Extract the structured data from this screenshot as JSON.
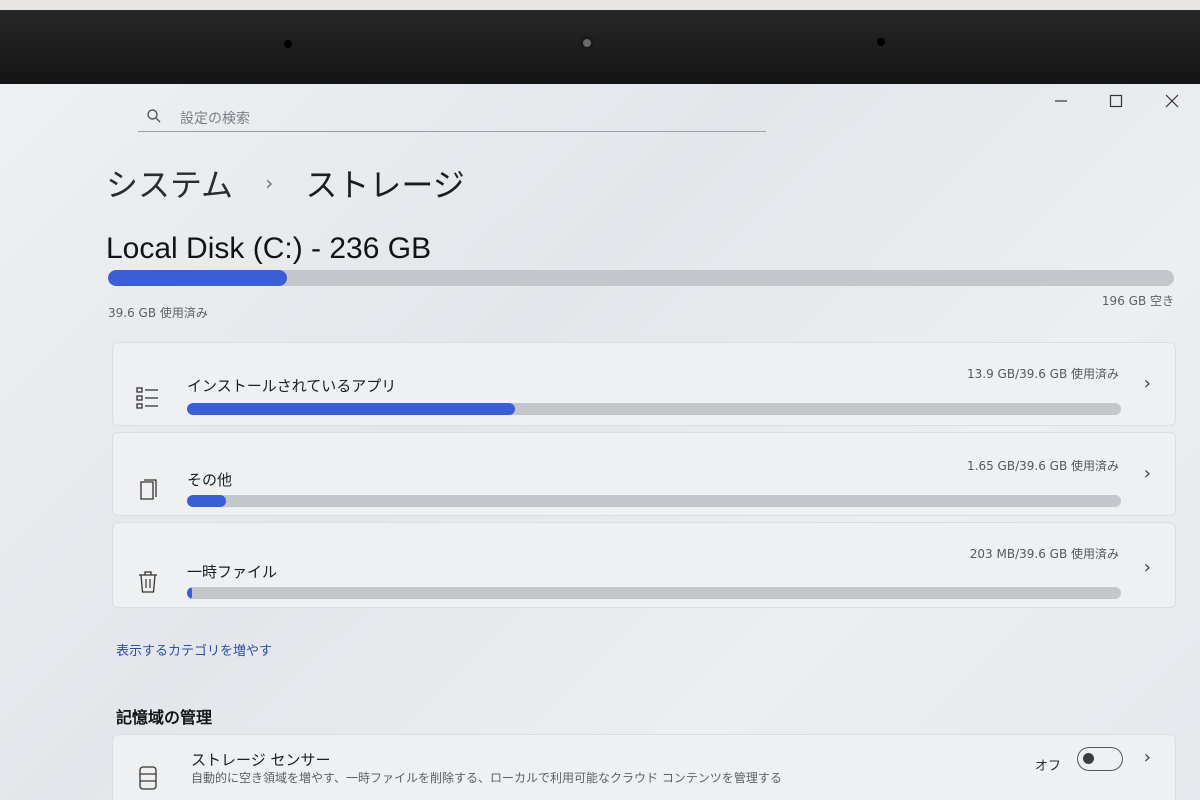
{
  "search": {
    "placeholder": "設定の検索"
  },
  "breadcrumb": {
    "parent": "システム",
    "separator": "›",
    "current": "ストレージ"
  },
  "disk": {
    "title": "Local Disk (C:) - 236 GB",
    "used_label": "39.6 GB 使用済み",
    "free_label": "196 GB 空き",
    "used_fraction": 0.168
  },
  "categories": [
    {
      "icon": "app-list-icon",
      "title": "インストールされているアプリ",
      "usage": "13.9 GB/39.6 GB 使用済み",
      "fraction": 0.351
    },
    {
      "icon": "document-stack-icon",
      "title": "その他",
      "usage": "1.65 GB/39.6 GB 使用済み",
      "fraction": 0.042
    },
    {
      "icon": "trash-icon",
      "title": "一時ファイル",
      "usage": "203 MB/39.6 GB 使用済み",
      "fraction": 0.005
    }
  ],
  "more_categories_link": "表示するカテゴリを増やす",
  "storage_management": {
    "section_title": "記憶域の管理",
    "storage_sense": {
      "title": "ストレージ センサー",
      "description": "自動的に空き領域を増やす、一時ファイルを削除する、ローカルで利用可能なクラウド コンテンツを管理する",
      "toggle_label": "オフ",
      "toggle_on": false
    }
  },
  "colors": {
    "accent": "#3a5fd4",
    "track": "#c3c6cb",
    "link": "#2b4fa8"
  }
}
